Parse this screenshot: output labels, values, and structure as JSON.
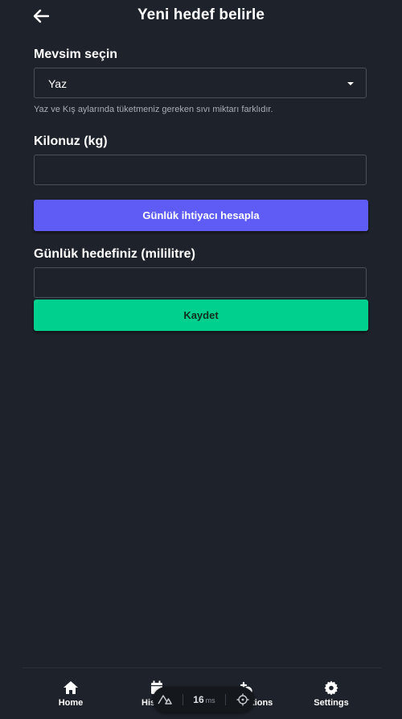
{
  "header": {
    "title": "Yeni hedef belirle",
    "back_icon": "arrow-left-icon"
  },
  "season": {
    "label": "Mevsim seçin",
    "selected": "Yaz",
    "hint": "Yaz ve Kış aylarında tüketmeniz gereken sıvı miktarı farklıdır."
  },
  "weight": {
    "label": "Kilonuz (kg)",
    "value": ""
  },
  "calculate_button": {
    "label": "Günlük ihtiyacı hesapla",
    "color": "#5e5cf5"
  },
  "goal": {
    "label": "Günlük hedefiniz (mililitre)",
    "value": ""
  },
  "save_button": {
    "label": "Kaydet",
    "color": "#00d08e"
  },
  "bottom_nav": {
    "items": [
      {
        "label": "Home",
        "icon": "home-icon"
      },
      {
        "label": "History",
        "icon": "calendar-icon"
      },
      {
        "label": "Notifications",
        "icon": "notification-icon"
      },
      {
        "label": "Settings",
        "icon": "gear-icon"
      }
    ]
  },
  "dev_overlay": {
    "render_time": "16",
    "unit": "ms",
    "icons": [
      "nuxt-logo-icon",
      "crosshair-icon"
    ]
  }
}
